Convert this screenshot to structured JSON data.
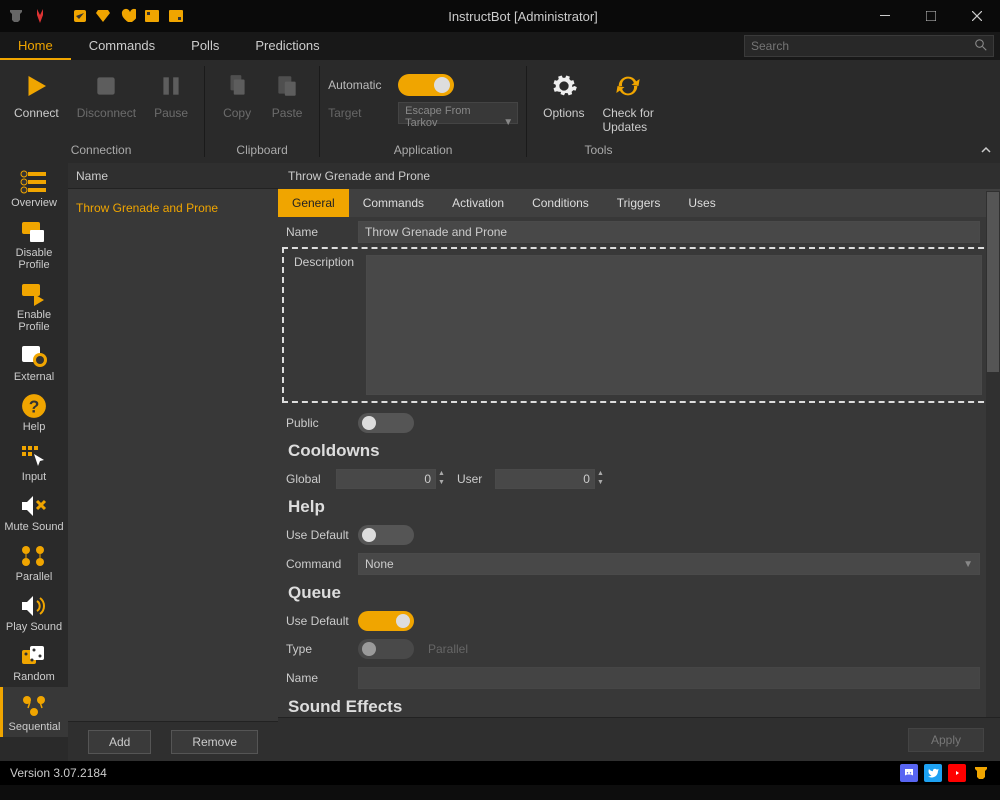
{
  "window": {
    "title": "InstructBot [Administrator]"
  },
  "tabs": {
    "home": "Home",
    "commands": "Commands",
    "polls": "Polls",
    "predictions": "Predictions"
  },
  "search": {
    "placeholder": "Search"
  },
  "ribbon": {
    "groups": {
      "connection": "Connection",
      "clipboard": "Clipboard",
      "application": "Application",
      "tools": "Tools"
    },
    "connect": "Connect",
    "disconnect": "Disconnect",
    "pause": "Pause",
    "copy": "Copy",
    "paste": "Paste",
    "automatic": "Automatic",
    "target": "Target",
    "target_value": "Escape From Tarkov",
    "options": "Options",
    "check_updates_line1": "Check for",
    "check_updates_line2": "Updates"
  },
  "sidebar": {
    "items": [
      {
        "label": "Overview"
      },
      {
        "label": "Disable Profile"
      },
      {
        "label": "Enable Profile"
      },
      {
        "label": "External"
      },
      {
        "label": "Help"
      },
      {
        "label": "Input"
      },
      {
        "label": "Mute Sound"
      },
      {
        "label": "Parallel"
      },
      {
        "label": "Play Sound"
      },
      {
        "label": "Random"
      },
      {
        "label": "Sequential"
      }
    ]
  },
  "name_panel": {
    "header": "Name",
    "items": [
      "Throw Grenade and Prone"
    ],
    "add": "Add",
    "remove": "Remove"
  },
  "detail": {
    "title": "Throw Grenade and Prone",
    "tabs": {
      "general": "General",
      "commands": "Commands",
      "activation": "Activation",
      "conditions": "Conditions",
      "triggers": "Triggers",
      "uses": "Uses"
    },
    "fields": {
      "name_label": "Name",
      "name_value": "Throw Grenade and Prone",
      "description_label": "Description",
      "public_label": "Public",
      "cooldowns_heading": "Cooldowns",
      "global_label": "Global",
      "global_value": "0",
      "user_label": "User",
      "user_value": "0",
      "help_heading": "Help",
      "use_default_label": "Use Default",
      "command_label": "Command",
      "command_value": "None",
      "queue_heading": "Queue",
      "queue_use_default_label": "Use Default",
      "type_label": "Type",
      "type_ghost": "Parallel",
      "queue_name_label": "Name",
      "sound_effects_heading": "Sound Effects"
    },
    "apply": "Apply"
  },
  "status": {
    "version": "Version 3.07.2184"
  }
}
